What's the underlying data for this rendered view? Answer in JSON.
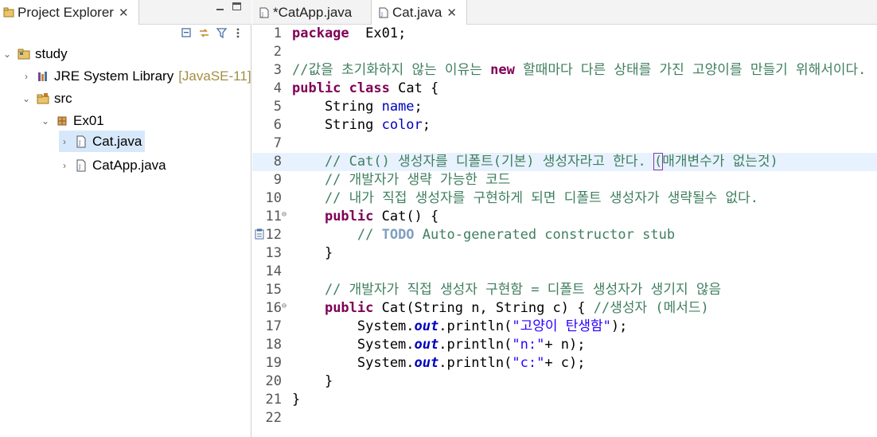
{
  "explorer": {
    "title": "Project Explorer",
    "close_glyph": "✕",
    "icons": {
      "tab": "package-explorer-icon",
      "collapse": "collapse-all-icon",
      "link": "link-with-editor-icon",
      "filter": "filter-icon",
      "menu": "view-menu-icon"
    },
    "tree": [
      {
        "label": "study",
        "icon": "project-folder-icon",
        "chevron": "expanded",
        "suffix": ""
      },
      {
        "label": "JRE System Library",
        "icon": "library-icon",
        "chevron": "collapsed",
        "suffix": "[JavaSE-11]"
      },
      {
        "label": "src",
        "icon": "source-folder-icon",
        "chevron": "expanded",
        "suffix": ""
      },
      {
        "label": "Ex01",
        "icon": "package-icon",
        "chevron": "expanded",
        "suffix": ""
      },
      {
        "label": "Cat.java",
        "icon": "java-file-icon",
        "chevron": "collapsed",
        "suffix": "",
        "selected": true
      },
      {
        "label": "CatApp.java",
        "icon": "java-file-icon",
        "chevron": "collapsed",
        "suffix": ""
      }
    ]
  },
  "editor": {
    "tabs": [
      {
        "label": "*CatApp.java",
        "active": false,
        "icon": "java-file-icon"
      },
      {
        "label": "Cat.java",
        "active": true,
        "icon": "java-file-icon",
        "close": "✕"
      }
    ],
    "current_line": 8,
    "lines": [
      {
        "n": "1",
        "tokens": [
          [
            "kw",
            "package"
          ],
          [
            "",
            "  Ex01;"
          ]
        ]
      },
      {
        "n": "2",
        "tokens": []
      },
      {
        "n": "3",
        "tokens": [
          [
            "cm",
            "//값을 초기화하지 않는 이유는 "
          ],
          [
            "kw",
            "new"
          ],
          [
            "cm",
            " 할때마다 다른 상태를 가진 고양이를 만들기 위해서이다."
          ]
        ]
      },
      {
        "n": "4",
        "tokens": [
          [
            "kw",
            "public"
          ],
          [
            "",
            " "
          ],
          [
            "kw",
            "class"
          ],
          [
            "",
            " Cat {"
          ]
        ]
      },
      {
        "n": "5",
        "tokens": [
          [
            "",
            "    String "
          ],
          [
            "fld",
            "name"
          ],
          [
            "",
            ";"
          ]
        ]
      },
      {
        "n": "6",
        "tokens": [
          [
            "",
            "    String "
          ],
          [
            "fld",
            "color"
          ],
          [
            "",
            ";"
          ]
        ]
      },
      {
        "n": "7",
        "tokens": []
      },
      {
        "n": "8",
        "tokens": [
          [
            "cm",
            "    // Cat() 생성자를 디폴트(기본) 생성자라고 한다. "
          ],
          [
            "cm bracket",
            "("
          ],
          [
            "cm",
            "매개변수가 없는것)"
          ]
        ]
      },
      {
        "n": "9",
        "tokens": [
          [
            "cm",
            "    // 개발자가 생략 가능한 코드"
          ]
        ]
      },
      {
        "n": "10",
        "tokens": [
          [
            "cm",
            "    // 내가 직접 생성자를 구현하게 되면 디폴트 생성자가 생략될수 없다."
          ]
        ]
      },
      {
        "n": "11",
        "fold": "⊖",
        "tokens": [
          [
            "",
            "    "
          ],
          [
            "kw",
            "public"
          ],
          [
            "",
            " Cat() {"
          ]
        ]
      },
      {
        "n": "12",
        "marker": "task-marker-icon",
        "tokens": [
          [
            "cm",
            "        // "
          ],
          [
            "todo",
            "TODO"
          ],
          [
            "cm",
            " Auto-generated constructor stub"
          ]
        ]
      },
      {
        "n": "13",
        "tokens": [
          [
            "",
            "    }"
          ]
        ]
      },
      {
        "n": "14",
        "tokens": []
      },
      {
        "n": "15",
        "tokens": [
          [
            "cm",
            "    // 개발자가 직접 생성자 구현함 = 디폴트 생성자가 생기지 않음"
          ]
        ]
      },
      {
        "n": "16",
        "fold": "⊖",
        "tokens": [
          [
            "",
            "    "
          ],
          [
            "kw",
            "public"
          ],
          [
            "",
            " Cat(String n, String c) { "
          ],
          [
            "cm",
            "//생성자 (메서드)"
          ]
        ]
      },
      {
        "n": "17",
        "tokens": [
          [
            "",
            "        System."
          ],
          [
            "sfld",
            "out"
          ],
          [
            "",
            ".println("
          ],
          [
            "str",
            "\"고양이 탄생함\""
          ],
          [
            "",
            ");"
          ]
        ]
      },
      {
        "n": "18",
        "tokens": [
          [
            "",
            "        System."
          ],
          [
            "sfld",
            "out"
          ],
          [
            "",
            ".println("
          ],
          [
            "str",
            "\"n:\""
          ],
          [
            "",
            "+ n);"
          ]
        ]
      },
      {
        "n": "19",
        "tokens": [
          [
            "",
            "        System."
          ],
          [
            "sfld",
            "out"
          ],
          [
            "",
            ".println("
          ],
          [
            "str",
            "\"c:\""
          ],
          [
            "",
            "+ c);"
          ]
        ]
      },
      {
        "n": "20",
        "tokens": [
          [
            "",
            "    }"
          ]
        ]
      },
      {
        "n": "21",
        "tokens": [
          [
            "",
            "}"
          ]
        ]
      },
      {
        "n": "22",
        "tokens": []
      }
    ]
  },
  "colors": {
    "keyword": "#7f0055",
    "comment": "#3f7f5f",
    "string": "#2a00ff",
    "field": "#0000c0",
    "selection": "#d7e8fb",
    "current_line": "#e8f2fe"
  }
}
